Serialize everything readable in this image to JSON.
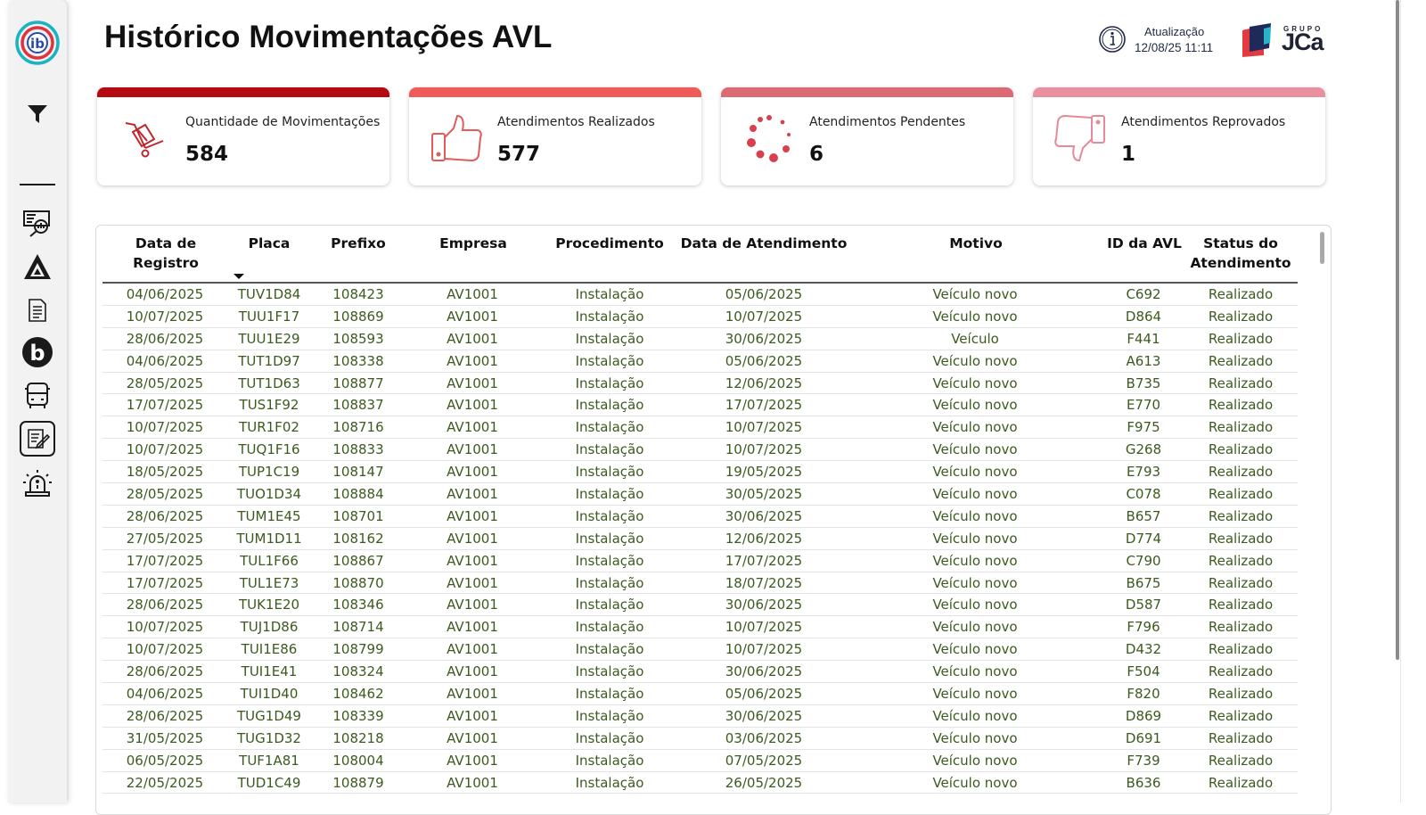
{
  "header": {
    "title": "Histórico Movimentações AVL",
    "update_label": "Atualização",
    "update_value": "12/08/25 11:11",
    "brand_small": "GRUPO",
    "brand_big": "JCa"
  },
  "sidebar": {
    "items": [
      {
        "name": "logo",
        "icon": "ib-logo-icon"
      },
      {
        "name": "filter",
        "icon": "filter-icon"
      },
      {
        "name": "report-search",
        "icon": "report-search-icon"
      },
      {
        "name": "triangle-brand",
        "icon": "triangle-logo-icon"
      },
      {
        "name": "document",
        "icon": "document-icon"
      },
      {
        "name": "b-brand",
        "icon": "b-logo-icon"
      },
      {
        "name": "bus",
        "icon": "bus-icon"
      },
      {
        "name": "history",
        "icon": "history-report-icon",
        "active": true
      },
      {
        "name": "alarm",
        "icon": "alarm-light-icon"
      }
    ]
  },
  "kpis": [
    {
      "label": "Quantidade de Movimentações",
      "value": "584",
      "color": "#b50a12",
      "icon": "hand-truck-icon"
    },
    {
      "label": "Atendimentos Realizados",
      "value": "577",
      "color": "#ee5b59",
      "icon": "thumbs-up-icon"
    },
    {
      "label": "Atendimentos Pendentes",
      "value": "6",
      "color": "#dc6a75",
      "icon": "loading-spinner-icon"
    },
    {
      "label": "Atendimentos Reprovados",
      "value": "1",
      "color": "#e890a0",
      "icon": "thumbs-down-icon"
    }
  ],
  "table": {
    "columns": [
      "Data de Registro",
      "Placa",
      "Prefixo",
      "Empresa",
      "Procedimento",
      "Data de Atendimento",
      "Motivo",
      "ID da AVL",
      "Status do Atendimento"
    ],
    "rows": [
      [
        "04/06/2025",
        "TUV1D84",
        "108423",
        "AV1001",
        "Instalação",
        "05/06/2025",
        "Veículo novo",
        "C692",
        "Realizado"
      ],
      [
        "10/07/2025",
        "TUU1F17",
        "108869",
        "AV1001",
        "Instalação",
        "10/07/2025",
        "Veículo novo",
        "D864",
        "Realizado"
      ],
      [
        "28/06/2025",
        "TUU1E29",
        "108593",
        "AV1001",
        "Instalação",
        "30/06/2025",
        "Veículo",
        "F441",
        "Realizado"
      ],
      [
        "04/06/2025",
        "TUT1D97",
        "108338",
        "AV1001",
        "Instalação",
        "05/06/2025",
        "Veículo novo",
        "A613",
        "Realizado"
      ],
      [
        "28/05/2025",
        "TUT1D63",
        "108877",
        "AV1001",
        "Instalação",
        "12/06/2025",
        "Veículo novo",
        "B735",
        "Realizado"
      ],
      [
        "17/07/2025",
        "TUS1F92",
        "108837",
        "AV1001",
        "Instalação",
        "17/07/2025",
        "Veículo novo",
        "E770",
        "Realizado"
      ],
      [
        "10/07/2025",
        "TUR1F02",
        "108716",
        "AV1001",
        "Instalação",
        "10/07/2025",
        "Veículo novo",
        "F975",
        "Realizado"
      ],
      [
        "10/07/2025",
        "TUQ1F16",
        "108833",
        "AV1001",
        "Instalação",
        "10/07/2025",
        "Veículo novo",
        "G268",
        "Realizado"
      ],
      [
        "18/05/2025",
        "TUP1C19",
        "108147",
        "AV1001",
        "Instalação",
        "19/05/2025",
        "Veículo novo",
        "E793",
        "Realizado"
      ],
      [
        "28/05/2025",
        "TUO1D34",
        "108884",
        "AV1001",
        "Instalação",
        "30/05/2025",
        "Veículo novo",
        "C078",
        "Realizado"
      ],
      [
        "28/06/2025",
        "TUM1E45",
        "108701",
        "AV1001",
        "Instalação",
        "30/06/2025",
        "Veículo novo",
        "B657",
        "Realizado"
      ],
      [
        "27/05/2025",
        "TUM1D11",
        "108162",
        "AV1001",
        "Instalação",
        "12/06/2025",
        "Veículo novo",
        "D774",
        "Realizado"
      ],
      [
        "17/07/2025",
        "TUL1F66",
        "108867",
        "AV1001",
        "Instalação",
        "17/07/2025",
        "Veículo novo",
        "C790",
        "Realizado"
      ],
      [
        "17/07/2025",
        "TUL1E73",
        "108870",
        "AV1001",
        "Instalação",
        "18/07/2025",
        "Veículo novo",
        "B675",
        "Realizado"
      ],
      [
        "28/06/2025",
        "TUK1E20",
        "108346",
        "AV1001",
        "Instalação",
        "30/06/2025",
        "Veículo novo",
        "D587",
        "Realizado"
      ],
      [
        "10/07/2025",
        "TUJ1D86",
        "108714",
        "AV1001",
        "Instalação",
        "10/07/2025",
        "Veículo novo",
        "F796",
        "Realizado"
      ],
      [
        "10/07/2025",
        "TUI1E86",
        "108799",
        "AV1001",
        "Instalação",
        "10/07/2025",
        "Veículo novo",
        "D432",
        "Realizado"
      ],
      [
        "28/06/2025",
        "TUI1E41",
        "108324",
        "AV1001",
        "Instalação",
        "30/06/2025",
        "Veículo novo",
        "F504",
        "Realizado"
      ],
      [
        "04/06/2025",
        "TUI1D40",
        "108462",
        "AV1001",
        "Instalação",
        "05/06/2025",
        "Veículo novo",
        "F820",
        "Realizado"
      ],
      [
        "28/06/2025",
        "TUG1D49",
        "108339",
        "AV1001",
        "Instalação",
        "30/06/2025",
        "Veículo novo",
        "D869",
        "Realizado"
      ],
      [
        "31/05/2025",
        "TUG1D32",
        "108218",
        "AV1001",
        "Instalação",
        "03/06/2025",
        "Veículo novo",
        "D691",
        "Realizado"
      ],
      [
        "06/05/2025",
        "TUF1A81",
        "108004",
        "AV1001",
        "Instalação",
        "07/05/2025",
        "Veículo novo",
        "F739",
        "Realizado"
      ],
      [
        "22/05/2025",
        "TUD1C49",
        "108879",
        "AV1001",
        "Instalação",
        "26/05/2025",
        "Veículo novo",
        "B636",
        "Realizado"
      ]
    ]
  }
}
